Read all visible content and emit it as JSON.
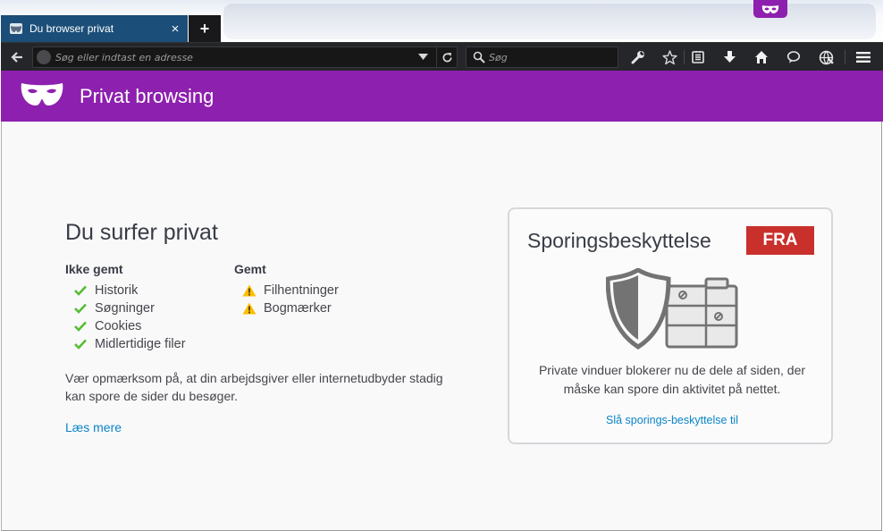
{
  "tab": {
    "title": "Du browser privat",
    "close_label": "×",
    "new_tab_label": "+"
  },
  "toolbar": {
    "url_placeholder": "Søg eller indtast en adresse",
    "search_placeholder": "Søg"
  },
  "header": {
    "title": "Privat browsing"
  },
  "main": {
    "title": "Du surfer privat",
    "not_saved": {
      "heading": "Ikke gemt",
      "items": [
        "Historik",
        "Søgninger",
        "Cookies",
        "Midlertidige filer"
      ]
    },
    "saved": {
      "heading": "Gemt",
      "items": [
        "Filhentninger",
        "Bogmærker"
      ]
    },
    "notice": "Vær opmærksom på, at din arbejdsgiver eller internetudbyder stadig kan spore de sider du besøger.",
    "learn_more": "Læs mere"
  },
  "tracking": {
    "title": "Sporingsbeskyttelse",
    "toggle": "FRA",
    "description": "Private vinduer blokerer nu de dele af siden, der måske kan spore din aktivitet på nettet.",
    "link": "Slå sporings-beskyttelse til"
  },
  "colors": {
    "private_purple": "#8d20ae",
    "toggle_red": "#c9302c",
    "link_blue": "#0a84c8",
    "check_green": "#57bd35",
    "warning_yellow": "#ffbf00"
  },
  "icons": {
    "tab_favicon": "private-mask-icon",
    "back": "back-arrow-icon",
    "reload": "reload-icon",
    "search": "search-icon",
    "tools": "wrench-icon",
    "bookmark": "star-icon",
    "reading_list": "reading-list-icon",
    "downloads": "download-icon",
    "home": "home-icon",
    "chat": "chat-bubble-icon",
    "web": "globe-icon",
    "menu": "hamburger-menu-icon"
  }
}
